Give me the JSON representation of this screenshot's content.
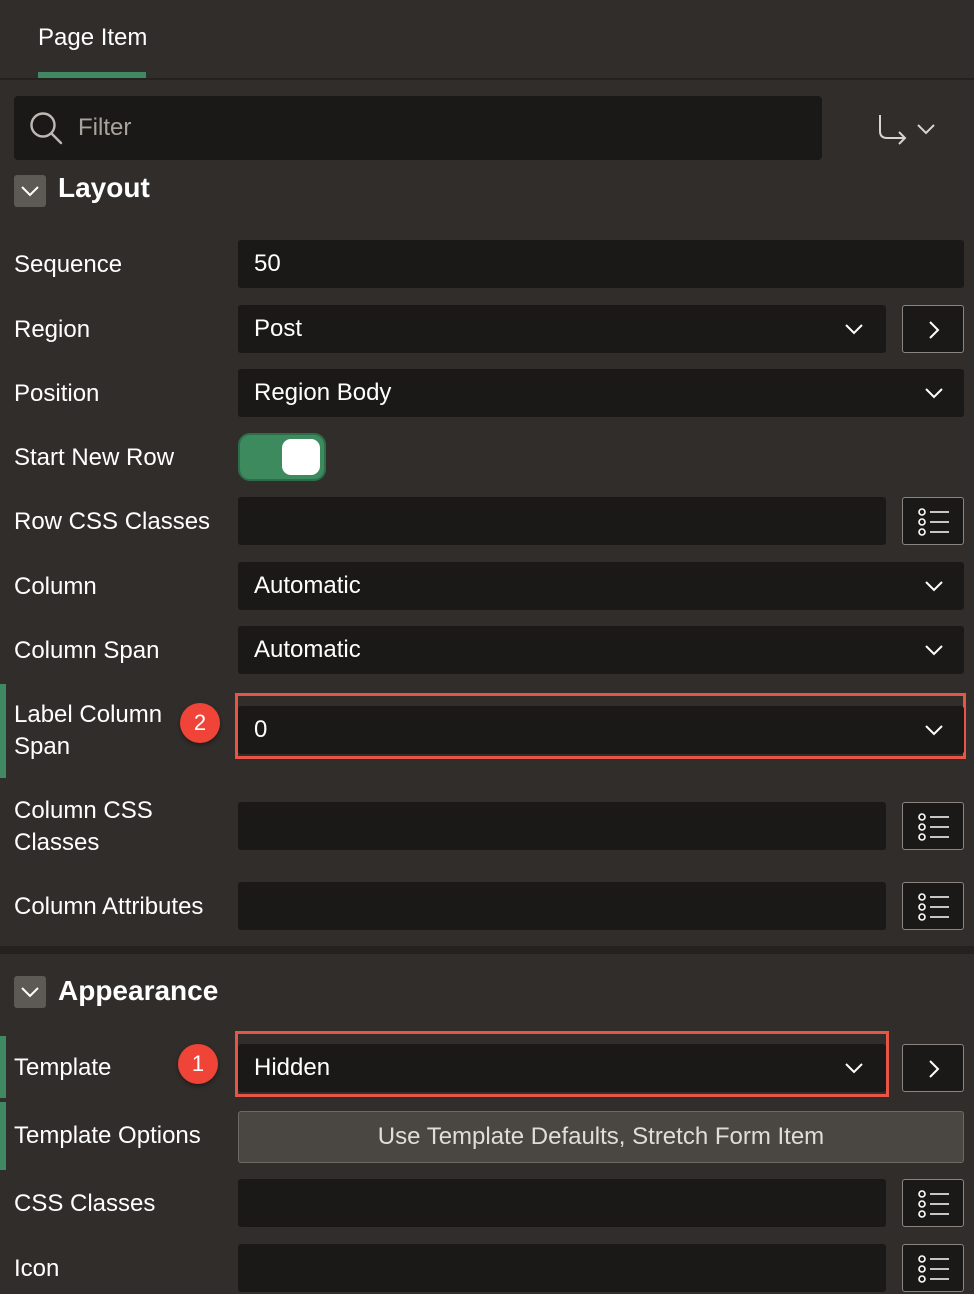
{
  "tab": {
    "label": "Page Item"
  },
  "filter": {
    "placeholder": "Filter"
  },
  "sections": {
    "layout": {
      "title": "Layout"
    },
    "appearance": {
      "title": "Appearance"
    }
  },
  "properties": {
    "sequence": {
      "label": "Sequence",
      "value": "50"
    },
    "region": {
      "label": "Region",
      "value": "Post"
    },
    "position": {
      "label": "Position",
      "value": "Region Body"
    },
    "start_new_row": {
      "label": "Start New Row"
    },
    "row_css_classes": {
      "label": "Row CSS Classes",
      "value": ""
    },
    "column": {
      "label": "Column",
      "value": "Automatic"
    },
    "column_span": {
      "label": "Column Span",
      "value": "Automatic"
    },
    "label_column_span": {
      "label_line1": "Label Column",
      "label_line2": "Span",
      "value": "0"
    },
    "column_css_classes": {
      "label_line1": "Column CSS",
      "label_line2": "Classes",
      "value": ""
    },
    "column_attributes": {
      "label": "Column Attributes",
      "value": ""
    },
    "template": {
      "label": "Template",
      "value": "Hidden"
    },
    "template_options": {
      "label": "Template Options",
      "value": "Use Template Defaults, Stretch Form Item"
    },
    "css_classes": {
      "label": "CSS Classes",
      "value": ""
    },
    "icon": {
      "label": "Icon",
      "value": ""
    }
  },
  "annotations": {
    "badge_1": "1",
    "badge_2": "2"
  },
  "colors": {
    "accent": "#3f8862",
    "highlight": "#e65545",
    "badge": "#f04438",
    "background": "#312d2a",
    "field": "#1b1917"
  },
  "icons": [
    "search-icon",
    "go-to-icon",
    "chevron-down-icon",
    "chevron-right-icon",
    "list-icon"
  ]
}
